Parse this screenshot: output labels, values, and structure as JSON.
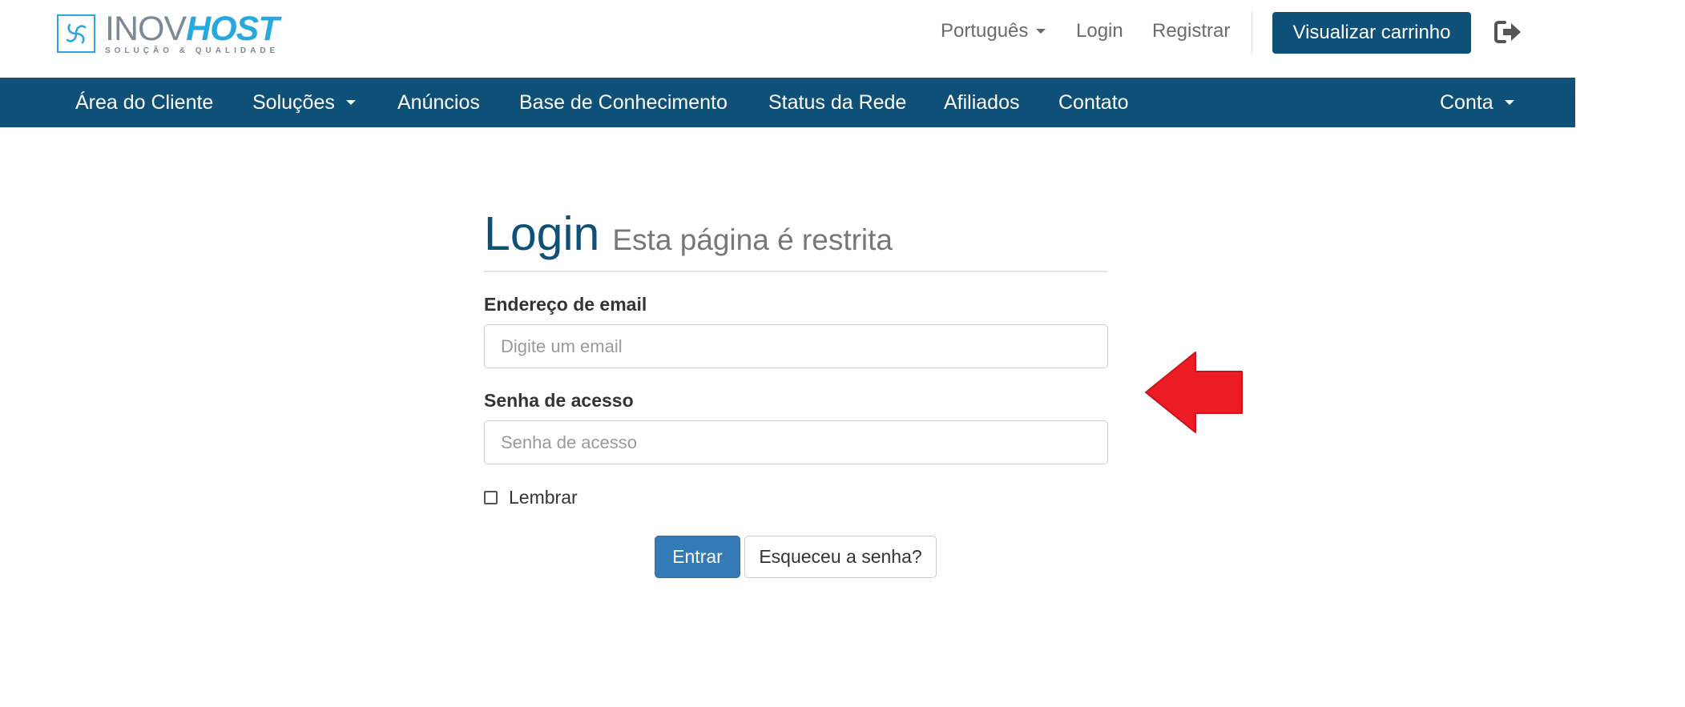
{
  "brand": {
    "name_part1": "INOV",
    "name_part2": "HOST",
    "tagline": "SOLUÇÃO & QUALIDADE",
    "color_primary": "#0f5078",
    "color_accent": "#29a8e0"
  },
  "topbar": {
    "language": "Português",
    "login": "Login",
    "register": "Registrar",
    "cart_button": "Visualizar carrinho",
    "logout_icon": "sign-out-icon"
  },
  "nav": {
    "items": [
      {
        "label": "Área do Cliente"
      },
      {
        "label": "Soluções",
        "dropdown": true
      },
      {
        "label": "Anúncios"
      },
      {
        "label": "Base de Conhecimento"
      },
      {
        "label": "Status da Rede"
      },
      {
        "label": "Afiliados"
      },
      {
        "label": "Contato"
      }
    ],
    "account": "Conta"
  },
  "login": {
    "title": "Login",
    "subtitle": "Esta página é restrita",
    "email_label": "Endereço de email",
    "email_placeholder": "Digite um email",
    "email_value": "",
    "password_label": "Senha de acesso",
    "password_placeholder": "Senha de acesso",
    "password_value": "",
    "remember_label": "Lembrar",
    "remember_checked": false,
    "submit_label": "Entrar",
    "forgot_label": "Esqueceu a senha?"
  },
  "annotation": {
    "arrow_color": "#ed1c24",
    "arrow_icon": "red-arrow-left-icon"
  }
}
